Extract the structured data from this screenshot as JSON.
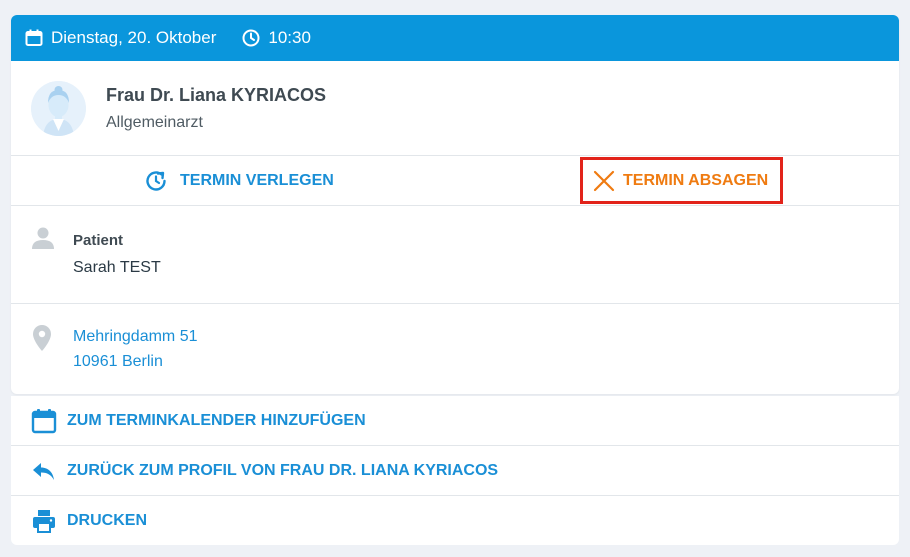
{
  "header": {
    "date": "Dienstag, 20. Oktober",
    "time": "10:30"
  },
  "doctor": {
    "name": "Frau Dr. Liana KYRIACOS",
    "specialty": "Allgemeinarzt"
  },
  "actions": {
    "reschedule": "TERMIN VERLEGEN",
    "cancel": "TERMIN ABSAGEN"
  },
  "patient": {
    "label": "Patient",
    "name": "Sarah TEST"
  },
  "address": {
    "street": "Mehringdamm 51",
    "city": "10961 Berlin"
  },
  "links": {
    "calendar": "ZUM TERMINKALENDER HINZUFÜGEN",
    "back": "ZURÜCK ZUM PROFIL VON FRAU DR. LIANA KYRIACOS",
    "print": "DRUCKEN"
  },
  "colors": {
    "header": "#0a96dc",
    "link": "#1a8fd6",
    "cancel": "#ef7b11",
    "highlight": "#e2231a"
  },
  "icons": {
    "date": "calendar-icon",
    "time": "clock-icon",
    "reschedule": "refresh-clock-icon",
    "cancel": "close-icon",
    "patient": "user-icon",
    "address": "map-pin-icon",
    "calendar_link": "calendar-icon",
    "back_link": "reply-arrow-icon",
    "print_link": "printer-icon"
  }
}
